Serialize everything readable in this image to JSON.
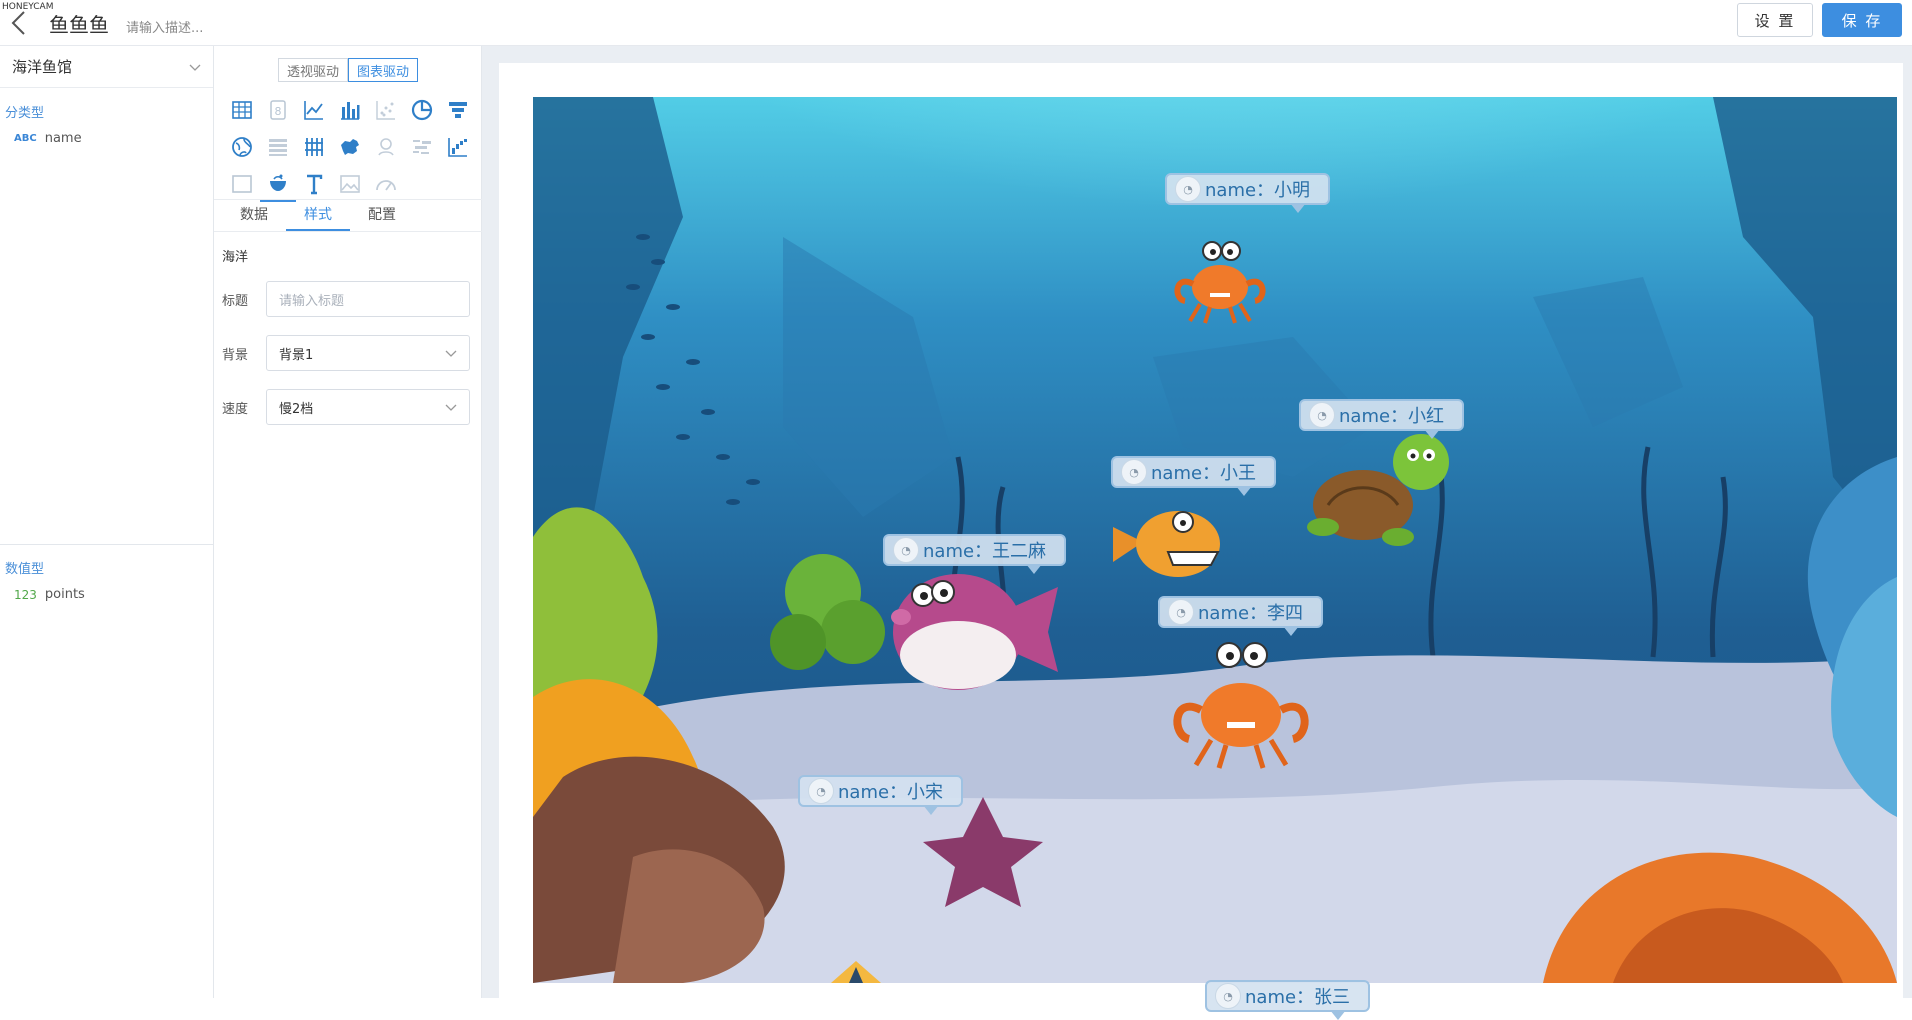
{
  "watermark": "HONEYCAM",
  "header": {
    "title": "鱼鱼鱼",
    "description_placeholder": "请输入描述...",
    "settings_label": "设 置",
    "save_label": "保 存"
  },
  "fields_panel": {
    "dataset": "海洋鱼馆",
    "dimension_group": "分类型",
    "dimension_fields": [
      {
        "type_tag": "ABC",
        "name": "name"
      }
    ],
    "measure_group": "数值型",
    "measure_fields": [
      {
        "type_tag": "123",
        "name": "points"
      }
    ]
  },
  "config_panel": {
    "modes": [
      "透视驱动",
      "图表驱动"
    ],
    "active_mode": "图表驱动",
    "chart_icons": [
      "table-icon",
      "number-card-icon",
      "line-chart-icon",
      "bar-chart-icon",
      "scatter-icon",
      "pie-chart-icon",
      "funnel-icon",
      "globe-icon",
      "list-icon",
      "crosstab-icon",
      "china-map-icon",
      "bubble-map-icon",
      "word-cloud-icon",
      "waterfall-icon",
      "blank-card-icon",
      "aquarium-icon",
      "text-icon",
      "image-icon",
      "gauge-icon"
    ],
    "selected_icon": "aquarium-icon",
    "tabs": [
      "数据",
      "样式",
      "配置"
    ],
    "active_tab": "样式",
    "section": "海洋",
    "title_label": "标题",
    "title_placeholder": "请输入标题",
    "background_label": "背景",
    "background_value": "背景1",
    "speed_label": "速度",
    "speed_value": "慢2档"
  },
  "aquarium": {
    "label_prefix": "name：",
    "creatures": [
      {
        "name": "小明",
        "kind": "crab"
      },
      {
        "name": "小红",
        "kind": "turtle"
      },
      {
        "name": "小王",
        "kind": "piranha"
      },
      {
        "name": "王二麻",
        "kind": "pufferfish"
      },
      {
        "name": "李四",
        "kind": "crab"
      },
      {
        "name": "小宋",
        "kind": "angelfish"
      },
      {
        "name": "张三",
        "kind": "fish"
      }
    ]
  },
  "colors": {
    "accent": "#3d8ee0",
    "ocean_top": "#4fc3e0",
    "ocean_deep": "#1f5f93",
    "sand": "#b9c3dc"
  }
}
